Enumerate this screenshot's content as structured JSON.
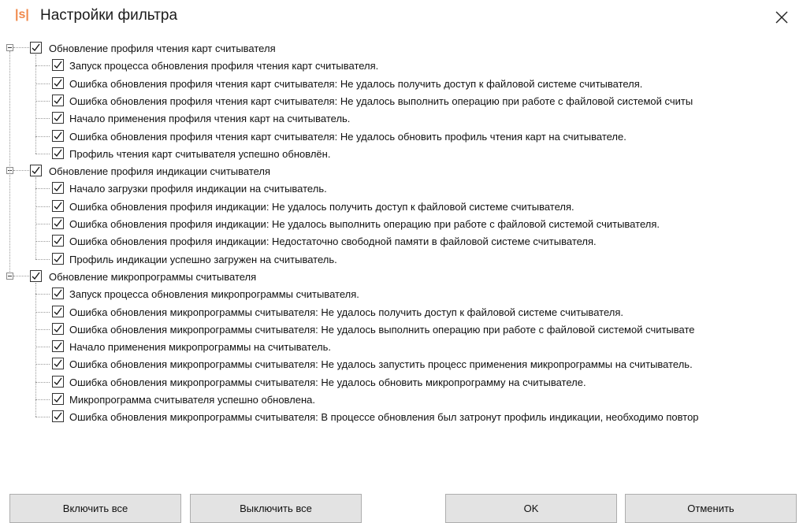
{
  "window": {
    "logo": "|s|",
    "title": "Настройки фильтра"
  },
  "groups": [
    {
      "label": "Обновление профиля чтения карт считывателя",
      "checked": true,
      "items": [
        "Запуск процесса обновления профиля чтения карт считывателя.",
        "Ошибка обновления профиля чтения карт считывателя: Не удалось получить доступ к файловой системе считывателя.",
        "Ошибка обновления профиля чтения карт считывателя: Не удалось выполнить операцию при работе с файловой системой считы",
        "Начало применения профиля чтения карт на считыватель.",
        "Ошибка обновления профиля чтения карт считывателя: Не удалось обновить профиль чтения карт на считывателе.",
        "Профиль чтения карт считывателя успешно обновлён."
      ]
    },
    {
      "label": "Обновление профиля индикации считывателя",
      "checked": true,
      "items": [
        "Начало загрузки профиля индикации на считыватель.",
        "Ошибка обновления профиля индикации: Не удалось получить доступ к файловой системе считывателя.",
        "Ошибка обновления профиля индикации: Не удалось выполнить операцию при работе с файловой системой считывателя.",
        "Ошибка обновления профиля индикации: Недостаточно свободной памяти в файловой системе считывателя.",
        "Профиль индикации успешно загружен на считыватель."
      ]
    },
    {
      "label": "Обновление микропрограммы считывателя",
      "checked": true,
      "items": [
        "Запуск процесса обновления микропрограммы считывателя.",
        "Ошибка обновления микропрограммы считывателя: Не удалось получить доступ к файловой системе считывателя.",
        "Ошибка обновления микропрограммы считывателя: Не удалось выполнить операцию при работе с файловой системой считывате",
        "Начало применения микропрограммы на считыватель.",
        "Ошибка обновления микропрограммы считывателя: Не удалось запустить процесс применения микропрограммы на считыватель.",
        "Ошибка обновления микропрограммы считывателя: Не удалось обновить микропрограмму на считывателе.",
        "Микропрограмма считывателя успешно обновлена.",
        "Ошибка обновления микропрограммы считывателя: В процессе обновления был затронут профиль индикации, необходимо повтор"
      ]
    }
  ],
  "buttons": {
    "enable_all": "Включить все",
    "disable_all": "Выключить все",
    "ok": "OK",
    "cancel": "Отменить"
  },
  "colors": {
    "logo": "#f0884a",
    "button_bg": "#e3e3e3",
    "button_border": "#adadad"
  },
  "icons": {
    "close": "close-icon",
    "check": "checkmark-icon",
    "expander": "collapse-minus-icon"
  }
}
